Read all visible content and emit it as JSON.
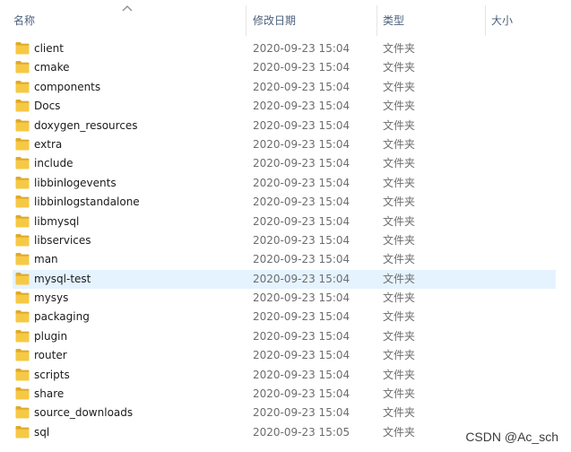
{
  "columns": {
    "name": "名称",
    "date": "修改日期",
    "type": "类型",
    "size": "大小",
    "sort_icon": "chevron-up-icon"
  },
  "colors": {
    "folder": "#f6c945",
    "folder_dark": "#e0a92a",
    "selected_row": "#e5f3ff",
    "header_text": "#4c607a"
  },
  "rows": [
    {
      "name": "client",
      "date": "2020-09-23 15:04",
      "type": "文件夹"
    },
    {
      "name": "cmake",
      "date": "2020-09-23 15:04",
      "type": "文件夹"
    },
    {
      "name": "components",
      "date": "2020-09-23 15:04",
      "type": "文件夹"
    },
    {
      "name": "Docs",
      "date": "2020-09-23 15:04",
      "type": "文件夹"
    },
    {
      "name": "doxygen_resources",
      "date": "2020-09-23 15:04",
      "type": "文件夹"
    },
    {
      "name": "extra",
      "date": "2020-09-23 15:04",
      "type": "文件夹"
    },
    {
      "name": "include",
      "date": "2020-09-23 15:04",
      "type": "文件夹"
    },
    {
      "name": "libbinlogevents",
      "date": "2020-09-23 15:04",
      "type": "文件夹"
    },
    {
      "name": "libbinlogstandalone",
      "date": "2020-09-23 15:04",
      "type": "文件夹"
    },
    {
      "name": "libmysql",
      "date": "2020-09-23 15:04",
      "type": "文件夹"
    },
    {
      "name": "libservices",
      "date": "2020-09-23 15:04",
      "type": "文件夹"
    },
    {
      "name": "man",
      "date": "2020-09-23 15:04",
      "type": "文件夹"
    },
    {
      "name": "mysql-test",
      "date": "2020-09-23 15:04",
      "type": "文件夹",
      "selected": true
    },
    {
      "name": "mysys",
      "date": "2020-09-23 15:04",
      "type": "文件夹"
    },
    {
      "name": "packaging",
      "date": "2020-09-23 15:04",
      "type": "文件夹"
    },
    {
      "name": "plugin",
      "date": "2020-09-23 15:04",
      "type": "文件夹"
    },
    {
      "name": "router",
      "date": "2020-09-23 15:04",
      "type": "文件夹"
    },
    {
      "name": "scripts",
      "date": "2020-09-23 15:04",
      "type": "文件夹"
    },
    {
      "name": "share",
      "date": "2020-09-23 15:04",
      "type": "文件夹"
    },
    {
      "name": "source_downloads",
      "date": "2020-09-23 15:04",
      "type": "文件夹"
    },
    {
      "name": "sql",
      "date": "2020-09-23 15:05",
      "type": "文件夹"
    }
  ],
  "watermark": "CSDN @Ac_sch"
}
